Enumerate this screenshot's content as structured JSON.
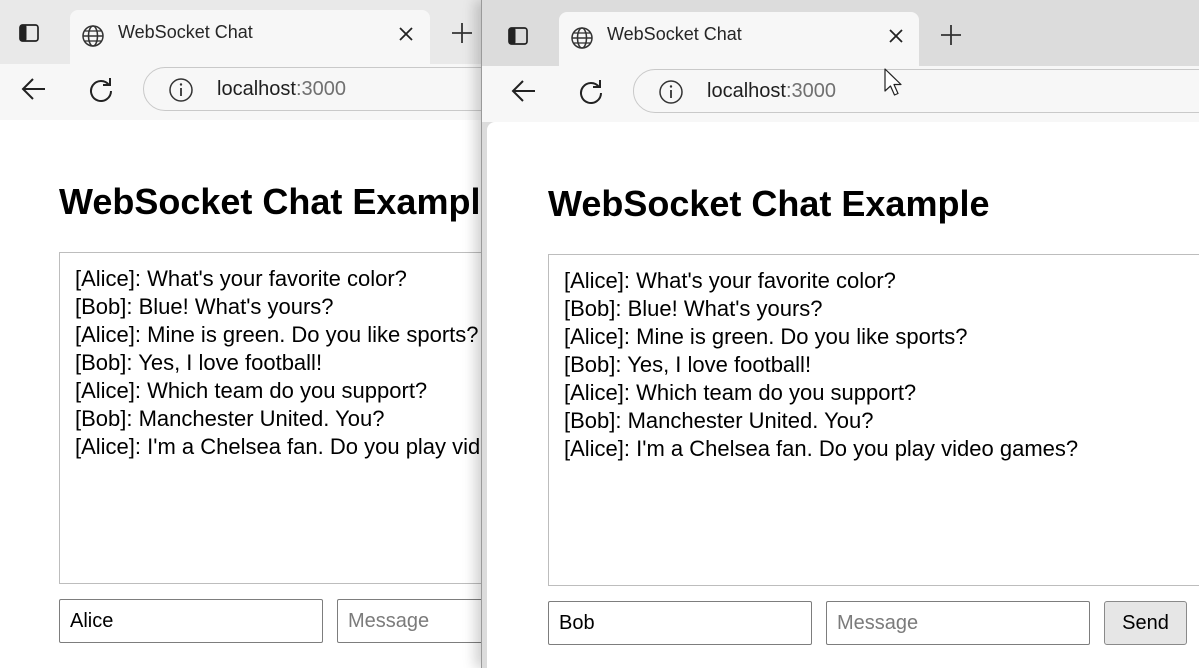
{
  "windows": [
    {
      "tab_title": "WebSocket Chat",
      "url_host": "localhost",
      "url_port": ":3000",
      "page_title": "WebSocket Chat Example",
      "messages": [
        "[Alice]: What's your favorite color?",
        "[Bob]: Blue! What's yours?",
        "[Alice]: Mine is green. Do you like sports?",
        "[Bob]: Yes, I love football!",
        "[Alice]: Which team do you support?",
        "[Bob]: Manchester United. You?",
        "[Alice]: I'm a Chelsea fan. Do you play video games?"
      ],
      "name_value": "Alice",
      "message_placeholder": "Message"
    },
    {
      "tab_title": "WebSocket Chat",
      "url_host": "localhost",
      "url_port": ":3000",
      "page_title": "WebSocket Chat Example",
      "messages": [
        "[Alice]: What's your favorite color?",
        "[Bob]: Blue! What's yours?",
        "[Alice]: Mine is green. Do you like sports?",
        "[Bob]: Yes, I love football!",
        "[Alice]: Which team do you support?",
        "[Bob]: Manchester United. You?",
        "[Alice]: I'm a Chelsea fan. Do you play video games?"
      ],
      "name_value": "Bob",
      "message_placeholder": "Message",
      "send_label": "Send"
    }
  ],
  "icons": {
    "sidebar": "sidebar-toggle-icon",
    "tab_favicon": "globe-icon",
    "close": "close-icon",
    "new_tab": "plus-icon",
    "back": "back-arrow-icon",
    "reload": "reload-icon",
    "site_info": "info-icon",
    "pointer": "mouse-cursor-icon"
  },
  "colors": {
    "tabstrip_bg": "#e9e9e9",
    "tab_active_bg": "#f7f7f7",
    "page_bg": "#ffffff",
    "url_port": "#707070",
    "placeholder": "#7b7b7b"
  }
}
